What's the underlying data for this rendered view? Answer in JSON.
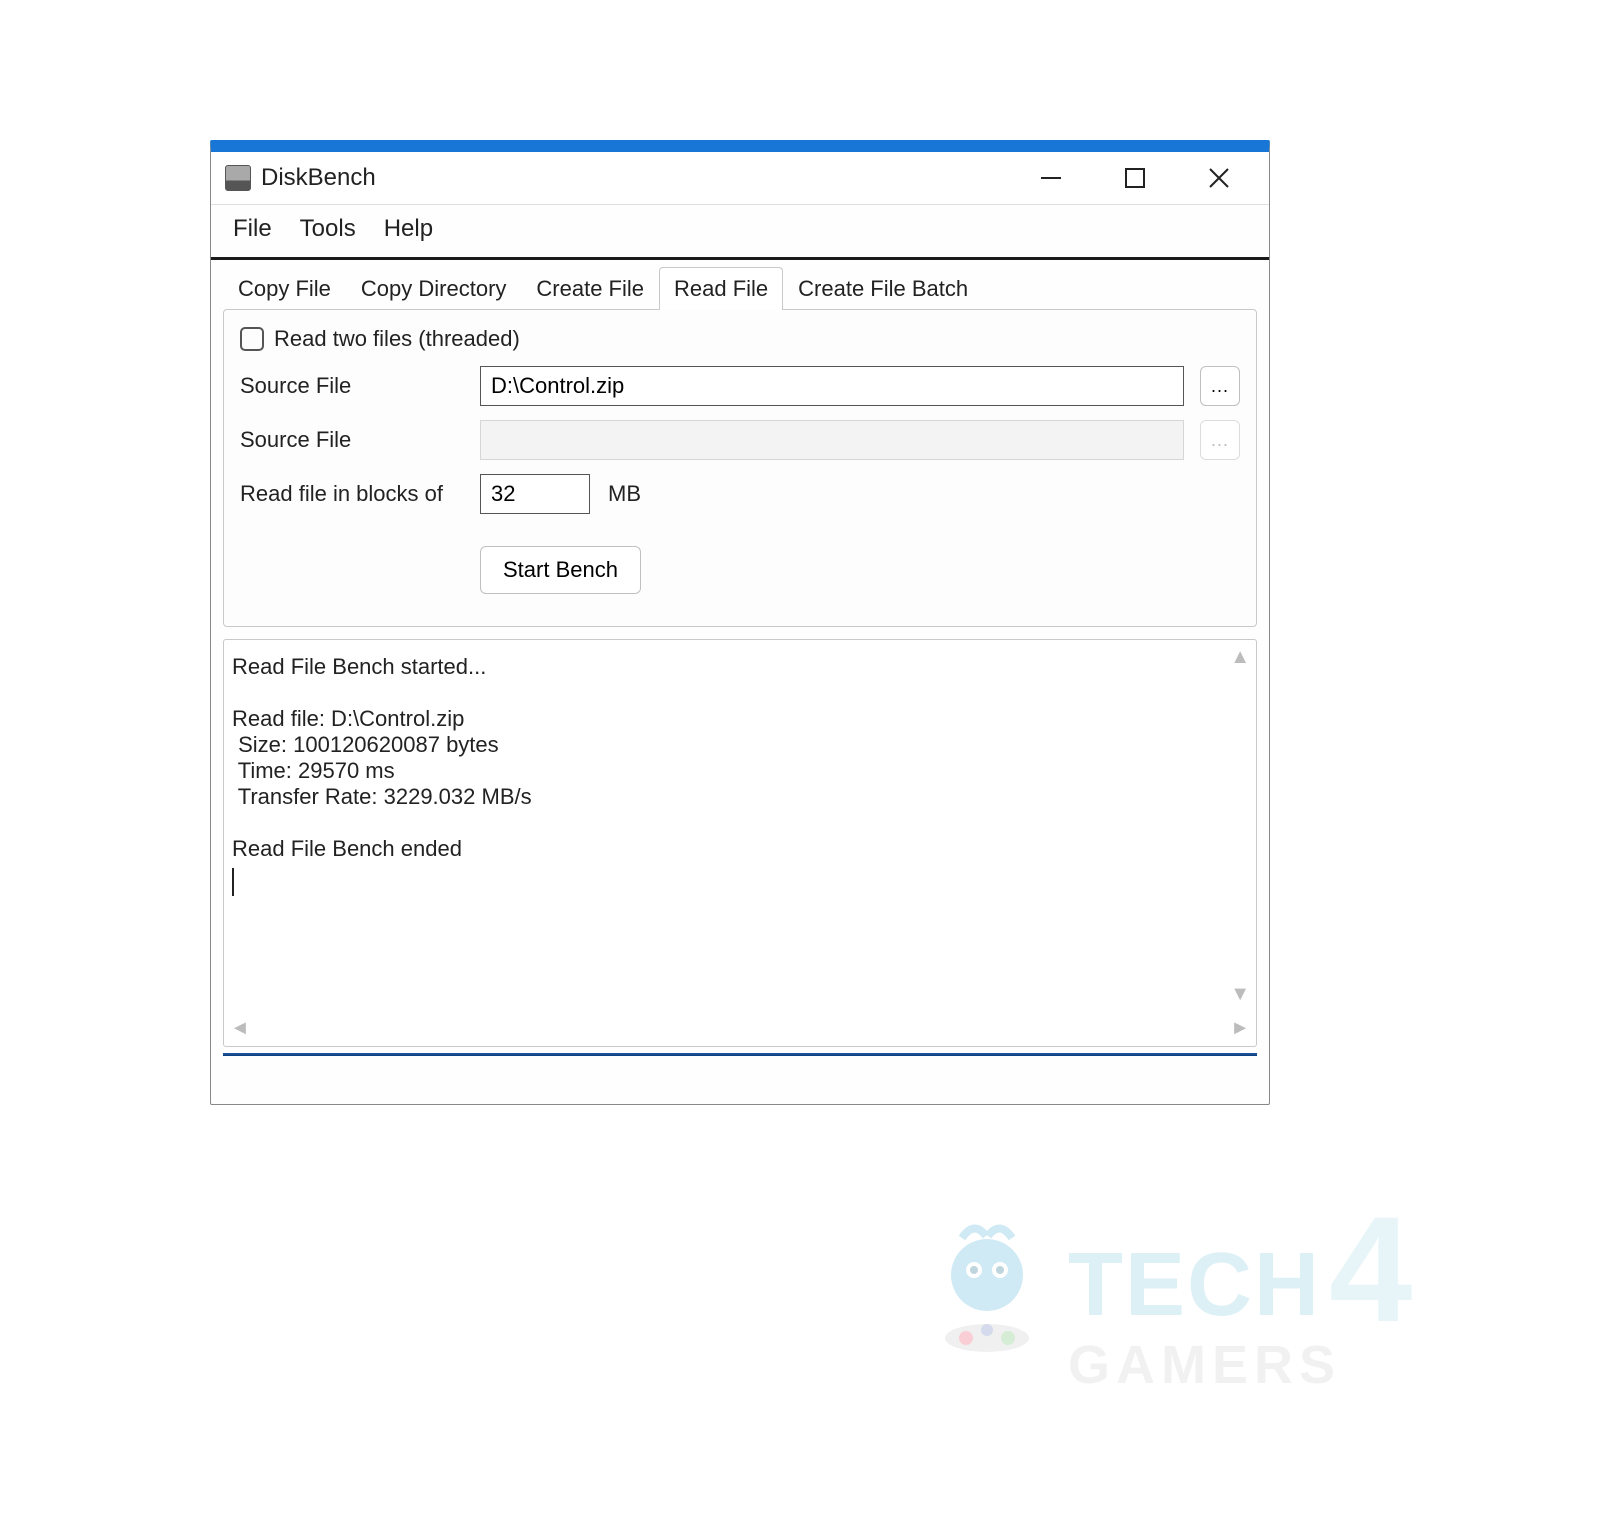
{
  "window": {
    "title": "DiskBench"
  },
  "menu": {
    "file": "File",
    "tools": "Tools",
    "help": "Help"
  },
  "tabs": {
    "copy_file": "Copy File",
    "copy_directory": "Copy Directory",
    "create_file": "Create File",
    "read_file": "Read File",
    "create_file_batch": "Create File Batch",
    "active": "read_file"
  },
  "panel": {
    "threaded_label": "Read two files (threaded)",
    "threaded_checked": false,
    "source_file_label": "Source File",
    "source_file_1": "D:\\Control.zip",
    "source_file_2": "",
    "browse_ellipsis": "...",
    "blocks_label": "Read file in blocks of",
    "blocks_value": "32",
    "blocks_unit": "MB",
    "start_button": "Start Bench"
  },
  "output": {
    "line1": "Read File Bench started...",
    "line2": "Read file: D:\\Control.zip",
    "line3": " Size: 100120620087 bytes",
    "line4": " Time: 29570 ms",
    "line5": " Transfer Rate: 3229.032 MB/s",
    "line6": "Read File Bench ended"
  },
  "watermark": {
    "tech": "TECH",
    "four": "4",
    "gamers": "GAMERS"
  }
}
